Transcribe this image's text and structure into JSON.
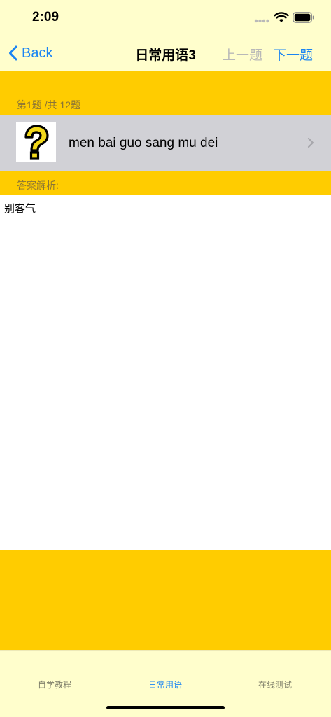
{
  "status_bar": {
    "time": "2:09"
  },
  "nav": {
    "back_label": "Back",
    "title": "日常用语3",
    "prev_label": "上一题",
    "next_label": "下一题"
  },
  "question": {
    "counter": "第1题 /共 12题",
    "image_icon": "question-mark-icon",
    "text": "men bai guo sang mu dei"
  },
  "answer": {
    "label": "答案解析:",
    "text": "别客气"
  },
  "tabs": [
    {
      "label": "自学教程",
      "active": false
    },
    {
      "label": "日常用语",
      "active": true
    },
    {
      "label": "在线测试",
      "active": false
    }
  ],
  "colors": {
    "accent": "#1a84f3",
    "band_yellow": "#ffcc00",
    "bar_background": "#fffecc",
    "row_gray": "#d1d1d6"
  }
}
